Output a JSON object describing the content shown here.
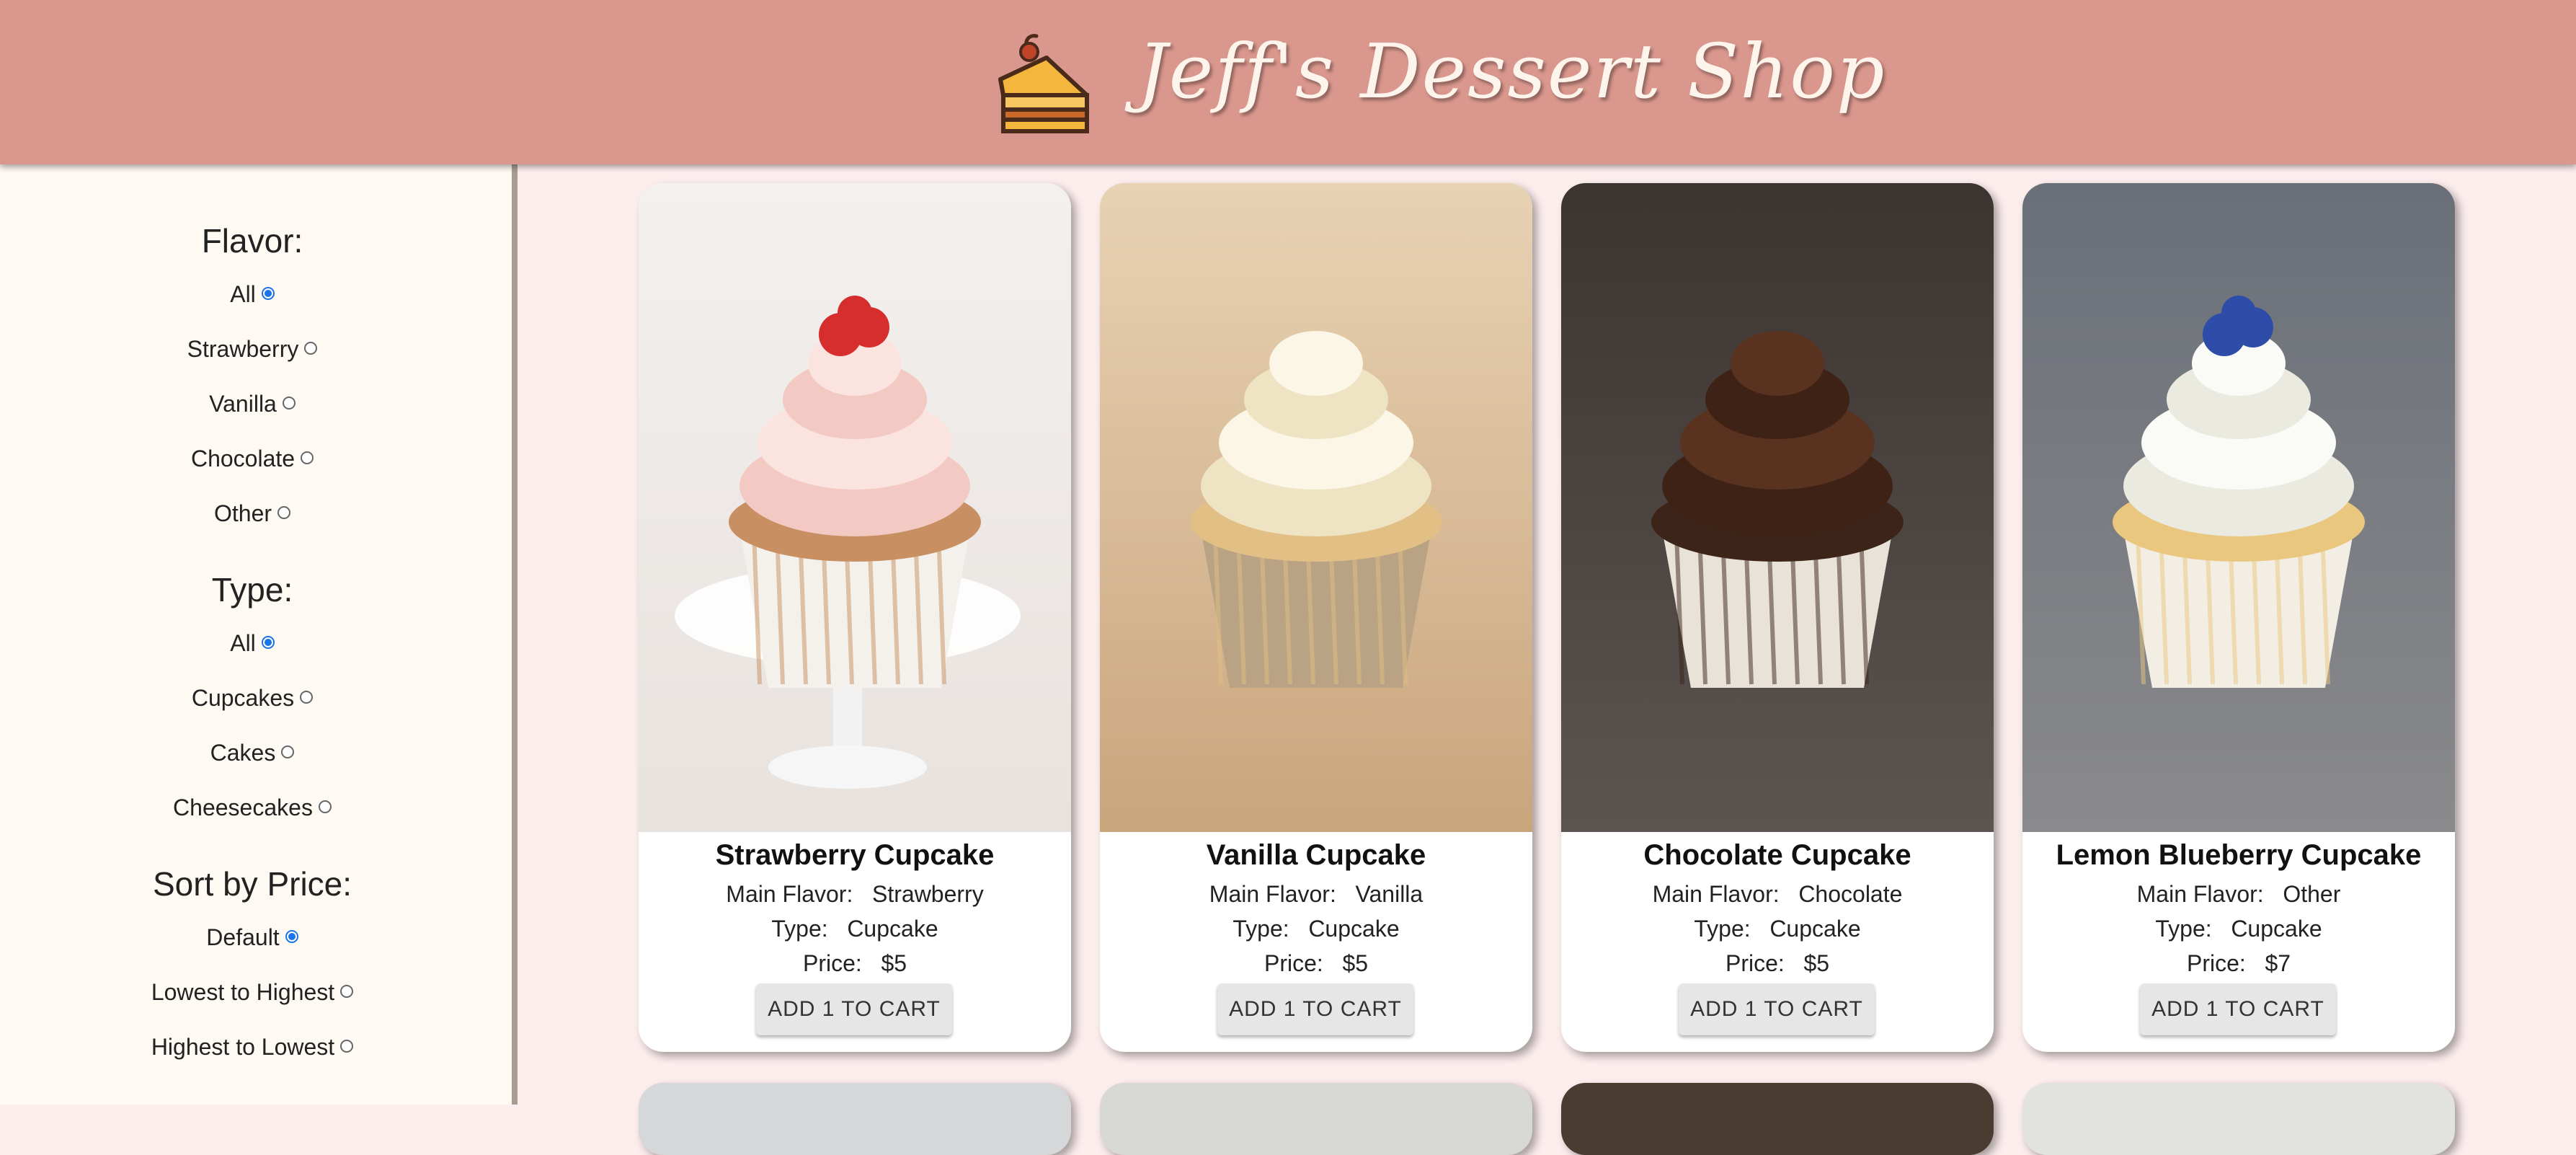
{
  "header": {
    "title": "Jeff's Dessert Shop",
    "logo_icon": "cake-slice-icon"
  },
  "filters": {
    "flavor": {
      "label": "Flavor:",
      "options": [
        "All",
        "Strawberry",
        "Vanilla",
        "Chocolate",
        "Other"
      ],
      "selected": "All"
    },
    "type": {
      "label": "Type:",
      "options": [
        "All",
        "Cupcakes",
        "Cakes",
        "Cheesecakes"
      ],
      "selected": "All"
    },
    "sort": {
      "label": "Sort by Price:",
      "options": [
        "Default",
        "Lowest to Highest",
        "Highest to Lowest"
      ],
      "selected": "Default"
    }
  },
  "field_labels": {
    "flavor": "Main Flavor:",
    "type": "Type:",
    "price": "Price:"
  },
  "products": [
    {
      "name": "Strawberry Cupcake",
      "flavor": "Strawberry",
      "type": "Cupcake",
      "price": "$5",
      "button": "ADD 1 TO CART"
    },
    {
      "name": "Vanilla Cupcake",
      "flavor": "Vanilla",
      "type": "Cupcake",
      "price": "$5",
      "button": "ADD 1 TO CART"
    },
    {
      "name": "Chocolate Cupcake",
      "flavor": "Chocolate",
      "type": "Cupcake",
      "price": "$5",
      "button": "ADD 1 TO CART"
    },
    {
      "name": "Lemon Blueberry Cupcake",
      "flavor": "Other",
      "type": "Cupcake",
      "price": "$7",
      "button": "ADD 1 TO CART"
    }
  ],
  "colors": {
    "header_bg": "#d9978d",
    "sidebar_bg": "#fef9f2",
    "page_bg": "#fdeeee",
    "radio_selected": "#1a73e8"
  }
}
